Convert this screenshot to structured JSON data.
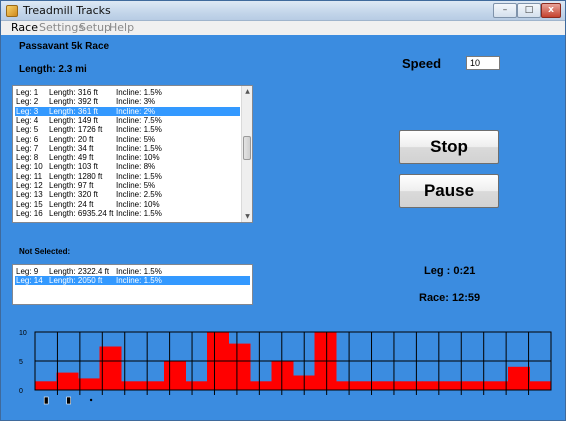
{
  "window": {
    "title": "Treadmill Tracks",
    "controls": {
      "minimize": "–",
      "maximize": "□",
      "close": "x"
    }
  },
  "menu": {
    "race": "Race",
    "settings": "Settings",
    "setup": "Setup",
    "help": "Help"
  },
  "race": {
    "title": "Passavant 5k Race",
    "length": "Length: 2.3 mi"
  },
  "speed": {
    "label": "Speed",
    "value": "10"
  },
  "legs": [
    {
      "leg": "Leg: 1",
      "length": "Length: 316 ft",
      "incline": "Incline: 1.5%"
    },
    {
      "leg": "Leg: 2",
      "length": "Length: 392 ft",
      "incline": "Incline: 3%"
    },
    {
      "leg": "Leg: 3",
      "length": "Length: 361 ft",
      "incline": "Incline: 2%",
      "selected": true
    },
    {
      "leg": "Leg: 4",
      "length": "Length: 149 ft",
      "incline": "Incline: 7.5%"
    },
    {
      "leg": "Leg: 5",
      "length": "Length: 1726 ft",
      "incline": "Incline: 1.5%"
    },
    {
      "leg": "Leg: 6",
      "length": "Length: 20 ft",
      "incline": "Incline: 5%"
    },
    {
      "leg": "Leg: 7",
      "length": "Length: 34 ft",
      "incline": "Incline: 1.5%"
    },
    {
      "leg": "Leg: 8",
      "length": "Length: 49 ft",
      "incline": "Incline: 10%"
    },
    {
      "leg": "Leg: 10",
      "length": "Length: 103 ft",
      "incline": "Incline: 8%"
    },
    {
      "leg": "Leg: 11",
      "length": "Length: 1280 ft",
      "incline": "Incline: 1.5%"
    },
    {
      "leg": "Leg: 12",
      "length": "Length: 97 ft",
      "incline": "Incline: 5%"
    },
    {
      "leg": "Leg: 13",
      "length": "Length: 320 ft",
      "incline": "Incline: 2.5%"
    },
    {
      "leg": "Leg: 15",
      "length": "Length: 24 ft",
      "incline": "Incline: 10%"
    },
    {
      "leg": "Leg: 16",
      "length": "Length: 6935.24 ft",
      "incline": "Incline: 1.5%"
    }
  ],
  "not_selected": {
    "label": "Not Selected:",
    "items": [
      {
        "leg": "Leg: 9",
        "length": "Length: 2322.4 ft",
        "incline": "Incline: 1.5%"
      },
      {
        "leg": "Leg: 14",
        "length": "Length: 2050 ft",
        "incline": "Incline: 1.5%",
        "selected": true
      }
    ]
  },
  "buttons": {
    "stop": "Stop",
    "pause": "Pause"
  },
  "timers": {
    "leg": "Leg : 0:21",
    "race": "Race: 12:59"
  },
  "colors": {
    "background": "#3b8ce0",
    "bars": "#ff0000",
    "selection": "#3399ff"
  },
  "chart_data": {
    "type": "bar",
    "ylim": [
      0,
      10
    ],
    "ytick_labels": [
      "10",
      "5",
      "0"
    ],
    "grid": true,
    "bar_color": "#ff0000",
    "background": "#3b8ce0",
    "values": [
      1.5,
      3,
      2,
      7.5,
      1.5,
      1.5,
      5,
      1.5,
      10,
      8,
      1.5,
      5,
      2.5,
      10,
      1.5,
      1.5,
      1.5,
      1.5,
      1.5,
      1.5,
      1.5,
      1.5,
      4,
      1.5
    ],
    "grid_columns": 23,
    "markers": [
      {
        "slot": 0,
        "icon": "runner-marker-icon"
      },
      {
        "slot": 1,
        "icon": "runner-marker-icon"
      },
      {
        "slot": 2,
        "icon": "dot-marker-icon"
      }
    ]
  }
}
